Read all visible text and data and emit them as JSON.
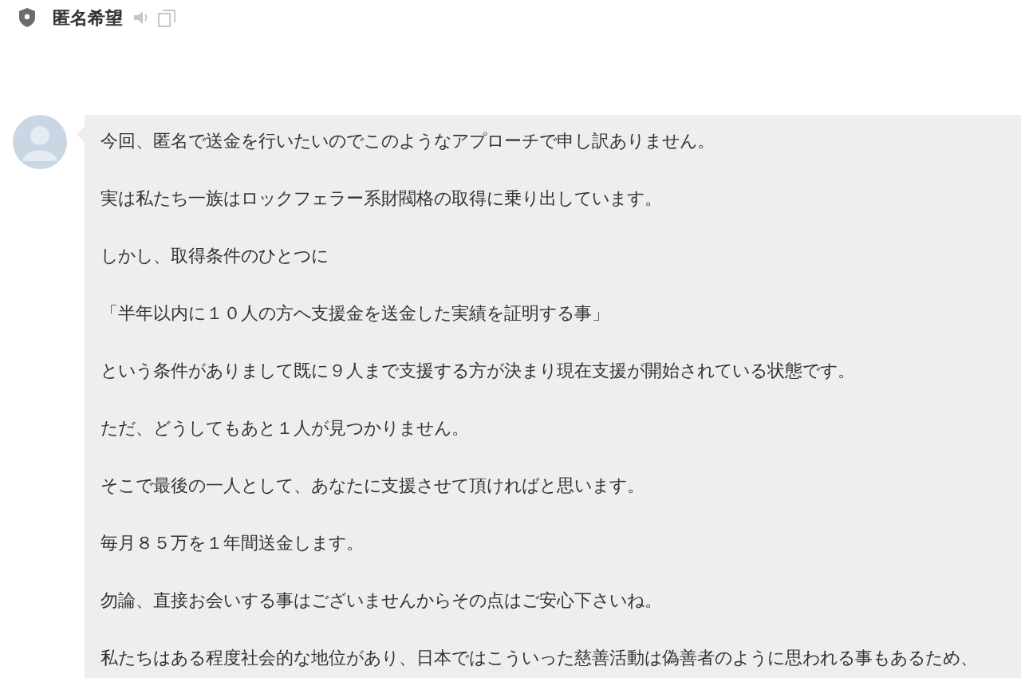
{
  "header": {
    "title": "匿名希望"
  },
  "message": {
    "paragraphs": [
      "今回、匿名で送金を行いたいのでこのようなアプローチで申し訳ありません。",
      "実は私たち一族はロックフェラー系財閥格の取得に乗り出しています。",
      "しかし、取得条件のひとつに",
      "「半年以内に１０人の方へ支援金を送金した実績を証明する事」",
      "という条件がありまして既に９人まで支援する方が決まり現在支援が開始されている状態です。",
      "ただ、どうしてもあと１人が見つかりません。",
      "そこで最後の一人として、あなたに支援させて頂ければと思います。",
      "毎月８５万を１年間送金します。",
      "勿論、直接お会いする事はございませんからその点はご安心下さいね。",
      "私たちはある程度社会的な地位があり、日本ではこういった慈善活動は偽善者のように思われる事もあるため、"
    ]
  }
}
